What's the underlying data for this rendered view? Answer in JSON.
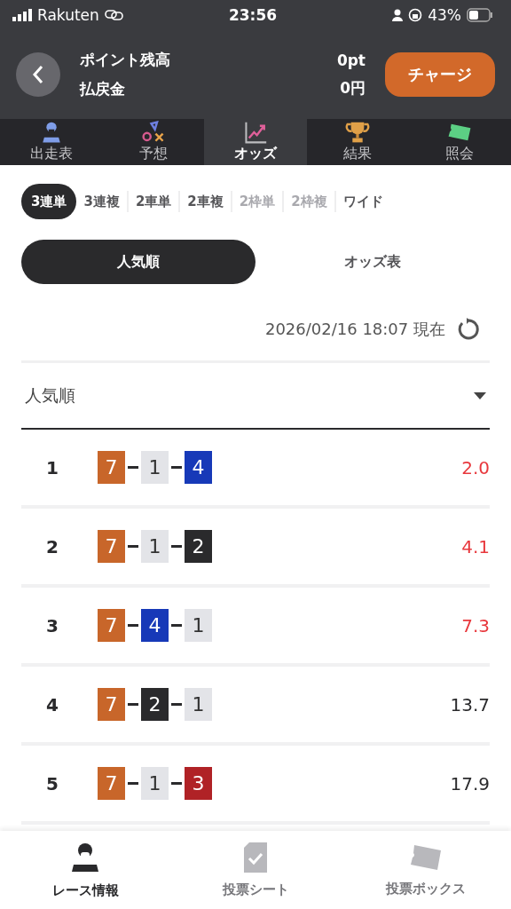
{
  "status_bar": {
    "carrier": "Rakuten",
    "time": "23:56",
    "battery": "43%"
  },
  "header": {
    "labels": [
      "ポイント残高",
      "払戻金"
    ],
    "values": [
      "0pt",
      "0円"
    ],
    "charge_button": "チャージ"
  },
  "nav_tabs": [
    {
      "label": "出走表",
      "kind": "rider",
      "selected": false
    },
    {
      "label": "予想",
      "kind": "symbols",
      "selected": false
    },
    {
      "label": "オッズ",
      "kind": "chart",
      "selected": true
    },
    {
      "label": "結果",
      "kind": "trophy",
      "selected": false
    },
    {
      "label": "照会",
      "kind": "ticket",
      "selected": false
    }
  ],
  "bet_types": [
    {
      "label": "3連単",
      "selected": true,
      "disabled": false
    },
    {
      "label": "3連複",
      "selected": false,
      "disabled": false
    },
    {
      "label": "2車単",
      "selected": false,
      "disabled": false
    },
    {
      "label": "2車複",
      "selected": false,
      "disabled": false
    },
    {
      "label": "2枠単",
      "selected": false,
      "disabled": true
    },
    {
      "label": "2枠複",
      "selected": false,
      "disabled": true
    },
    {
      "label": "ワイド",
      "selected": false,
      "disabled": false
    }
  ],
  "view_toggle": [
    {
      "label": "人気順",
      "selected": true
    },
    {
      "label": "オッズ表",
      "selected": false
    }
  ],
  "timestamp": "2026/02/16 18:07 現在",
  "sort_dropdown": "人気順",
  "odds_rows": [
    {
      "rank": "1",
      "combo": [
        {
          "number": "7",
          "color": "#c8662a"
        },
        {
          "number": "1",
          "color": "#e3e4e8"
        },
        {
          "number": "4",
          "color": "#1739b8"
        }
      ],
      "odds": "2.0",
      "highlighted": true
    },
    {
      "rank": "2",
      "combo": [
        {
          "number": "7",
          "color": "#c8662a"
        },
        {
          "number": "1",
          "color": "#e3e4e8"
        },
        {
          "number": "2",
          "color": "#2a2a2c"
        }
      ],
      "odds": "4.1",
      "highlighted": true
    },
    {
      "rank": "3",
      "combo": [
        {
          "number": "7",
          "color": "#c8662a"
        },
        {
          "number": "4",
          "color": "#1739b8"
        },
        {
          "number": "1",
          "color": "#e3e4e8"
        }
      ],
      "odds": "7.3",
      "highlighted": true
    },
    {
      "rank": "4",
      "combo": [
        {
          "number": "7",
          "color": "#c8662a"
        },
        {
          "number": "2",
          "color": "#2a2a2c"
        },
        {
          "number": "1",
          "color": "#e3e4e8"
        }
      ],
      "odds": "13.7",
      "highlighted": false
    },
    {
      "rank": "5",
      "combo": [
        {
          "number": "7",
          "color": "#c8662a"
        },
        {
          "number": "1",
          "color": "#e3e4e8"
        },
        {
          "number": "3",
          "color": "#b02226"
        }
      ],
      "odds": "17.9",
      "highlighted": false
    }
  ],
  "bottom_nav": [
    {
      "label": "レース情報",
      "kind": "rider",
      "selected": true
    },
    {
      "label": "投票シート",
      "kind": "sheet",
      "selected": false
    },
    {
      "label": "投票ボックス",
      "kind": "ticket",
      "selected": false
    }
  ]
}
